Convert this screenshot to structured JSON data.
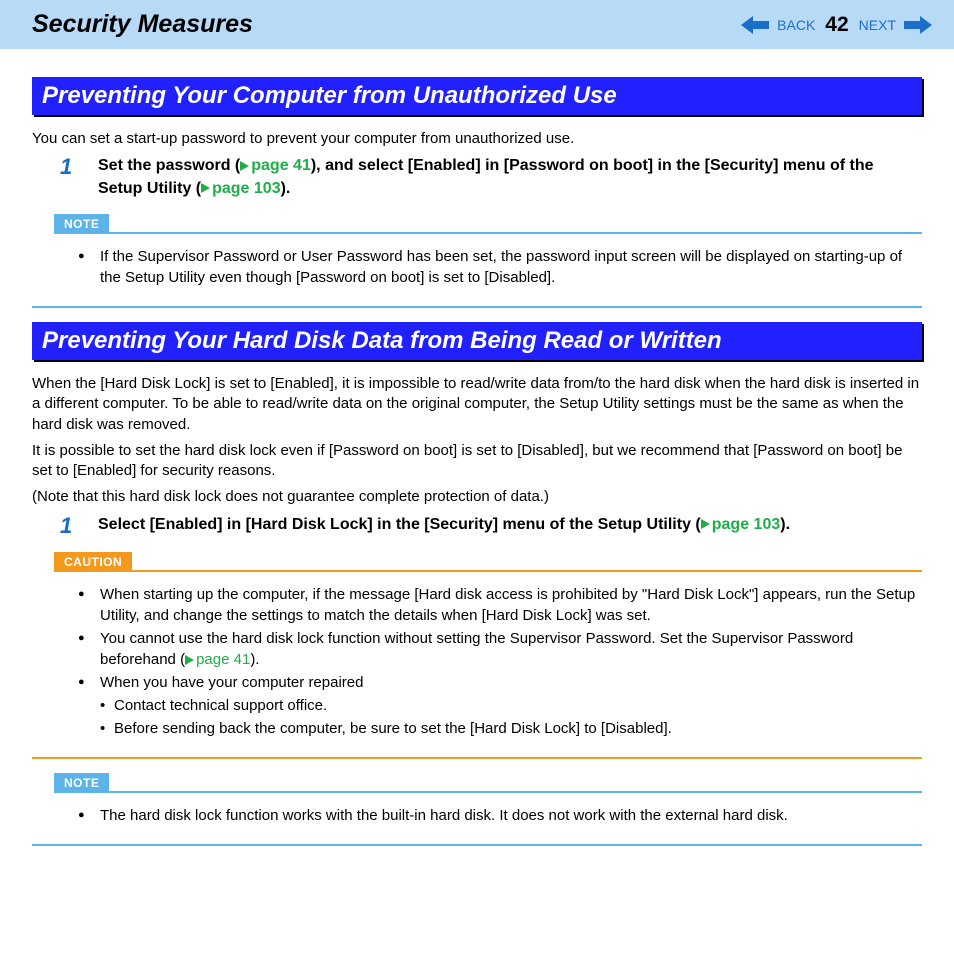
{
  "header": {
    "title": "Security Measures",
    "back_label": "BACK",
    "page_number": "42",
    "next_label": "NEXT"
  },
  "section1": {
    "heading": "Preventing Your Computer from Unauthorized Use",
    "intro": "You can set a start-up password to prevent your computer from unauthorized use.",
    "step_num": "1",
    "step_a": "Set the password (",
    "step_link1": "page 41",
    "step_b": "), and select [Enabled] in [Password on boot] in the [Security] menu of the Setup Utility (",
    "step_link2": "page 103",
    "step_c": ").",
    "note_label": "NOTE",
    "note_item": "If the Supervisor Password or User Password has been set, the password input screen will be displayed on starting-up of the Setup Utility even though [Password on boot] is set to [Disabled]."
  },
  "section2": {
    "heading": "Preventing Your Hard Disk Data from Being Read or Written",
    "intro1": "When the [Hard Disk Lock] is set to [Enabled], it is impossible to read/write data from/to the hard disk when the hard disk is inserted in a different computer. To be able to read/write data on the original computer, the Setup Utility settings must be the same as when the hard disk was removed.",
    "intro2": "It is possible to set the hard disk lock even if [Password on boot] is set to [Disabled], but we recommend that [Password on boot] be set to [Enabled] for security reasons.",
    "intro3": "(Note that this hard disk lock does not guarantee complete protection of data.)",
    "step_num": "1",
    "step_a": "Select [Enabled] in [Hard Disk Lock] in the [Security] menu of the Setup Utility (",
    "step_link": "page 103",
    "step_b": ").",
    "caution_label": "CAUTION",
    "caution1": "When starting up the computer, if the message [Hard disk access is prohibited by \"Hard Disk Lock\"] appears, run the Setup Utility, and change the settings to match the details when [Hard Disk Lock] was set.",
    "caution2_a": "You cannot use the hard disk lock function without setting the Supervisor Password. Set the Supervisor Password beforehand (",
    "caution2_link": "page 41",
    "caution2_b": ").",
    "caution3": "When you have your computer repaired",
    "caution3_sub1": "Contact technical support office.",
    "caution3_sub2": "Before sending back the computer, be sure to set the [Hard Disk Lock] to [Disabled].",
    "note_label": "NOTE",
    "note_item": "The hard disk lock function works with the built-in hard disk. It does not work with the external hard disk."
  }
}
